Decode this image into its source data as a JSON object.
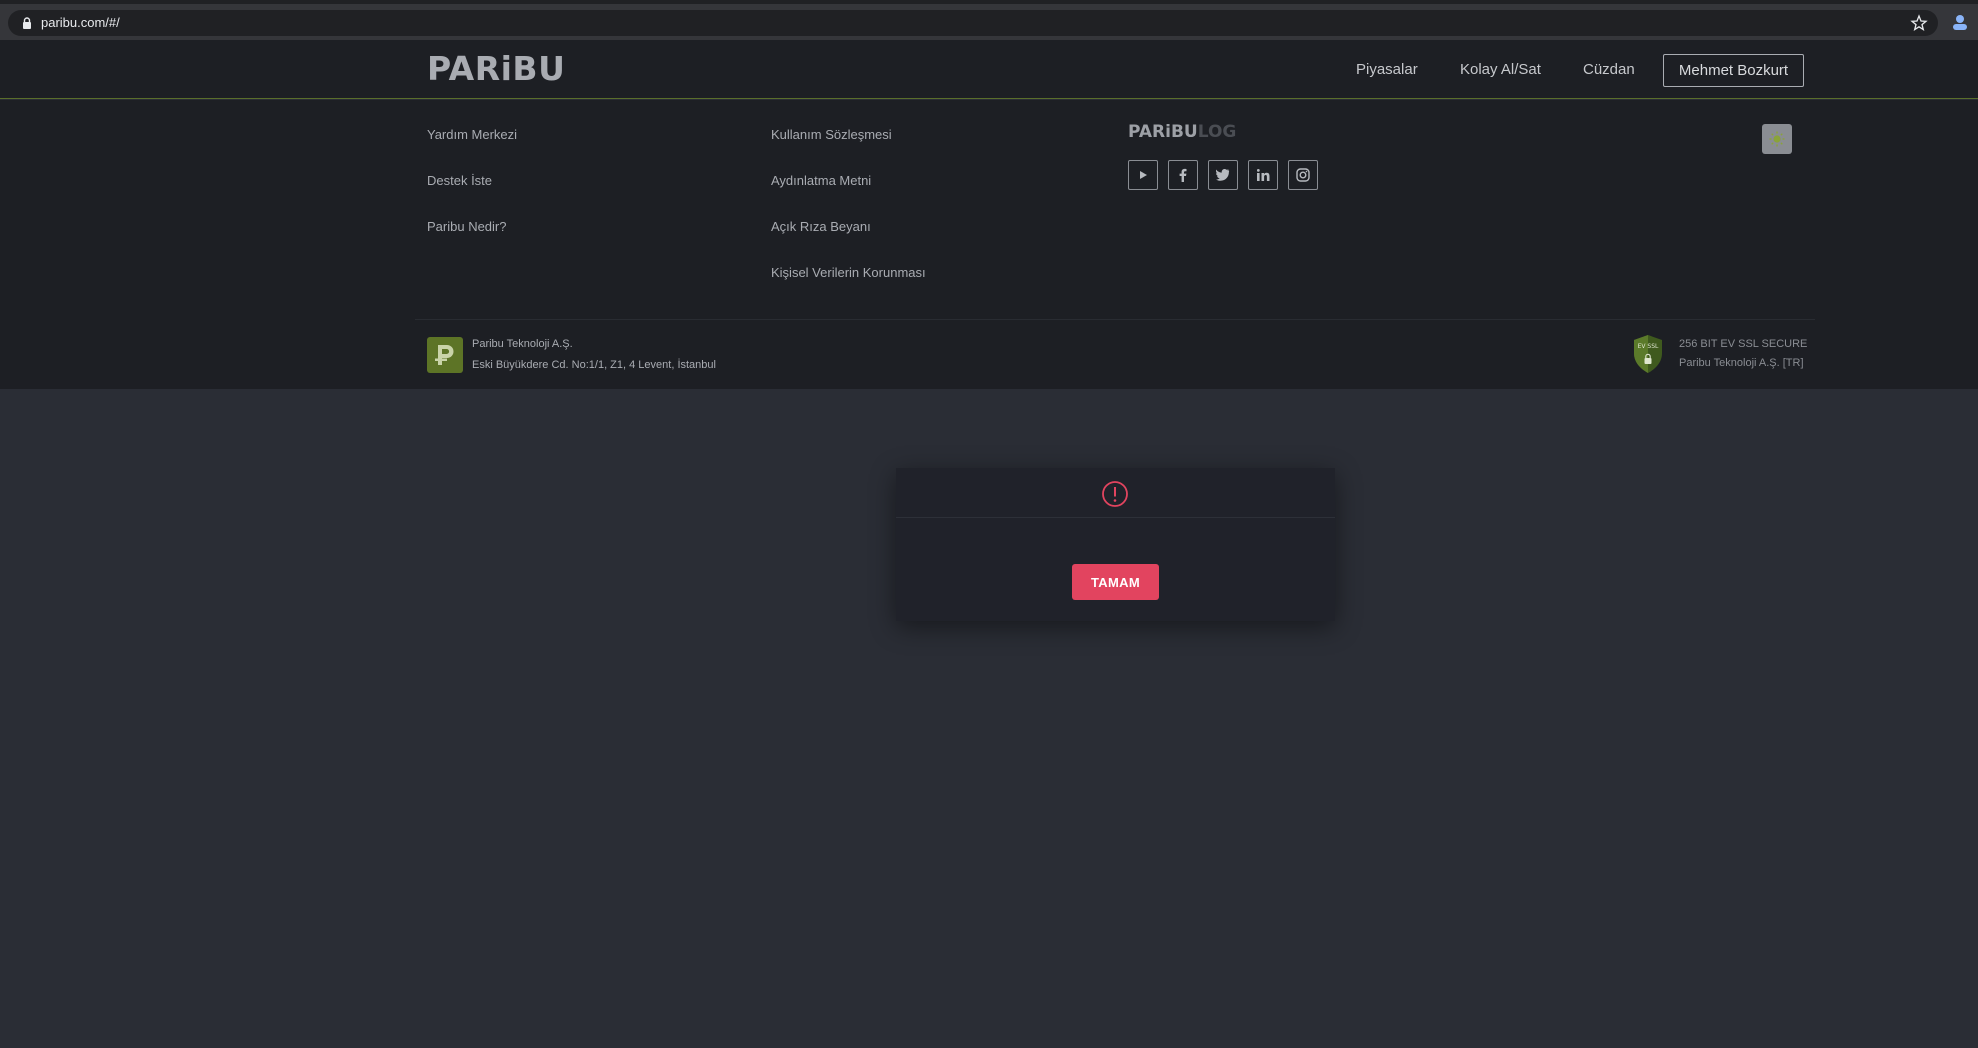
{
  "browser": {
    "url": "paribu.com/#/"
  },
  "header": {
    "logo": "PARiBU",
    "nav": [
      "Piyasalar",
      "Kolay Al/Sat",
      "Cüzdan"
    ],
    "user_name": "Mehmet Bozkurt"
  },
  "footer": {
    "col1": [
      "Yardım Merkezi",
      "Destek İste",
      "Paribu Nedir?"
    ],
    "col2": [
      "Kullanım Sözleşmesi",
      "Aydınlatma Metni",
      "Açık Rıza Beyanı",
      "Kişisel Verilerin Korunması"
    ],
    "brand_logo_a": "PARiBU",
    "brand_logo_b": "LOG",
    "social_icons": [
      "youtube-icon",
      "facebook-icon",
      "twitter-icon",
      "linkedin-icon",
      "instagram-icon"
    ],
    "company_name": "Paribu Teknoloji A.Ş.",
    "company_address": "Eski Büyükdere Cd. No:1/1, Z1, 4 Levent, İstanbul",
    "ssl_line1": "256 BIT EV SSL SECURE",
    "ssl_line2": "Paribu Teknoloji A.Ş.  [TR]",
    "ssl_badge_text": "EV SSL"
  },
  "modal": {
    "ok_label": "TAMAM"
  },
  "colors": {
    "accent": "#e2445f",
    "brand_green": "#5d7426",
    "background": "#2a2d35"
  }
}
